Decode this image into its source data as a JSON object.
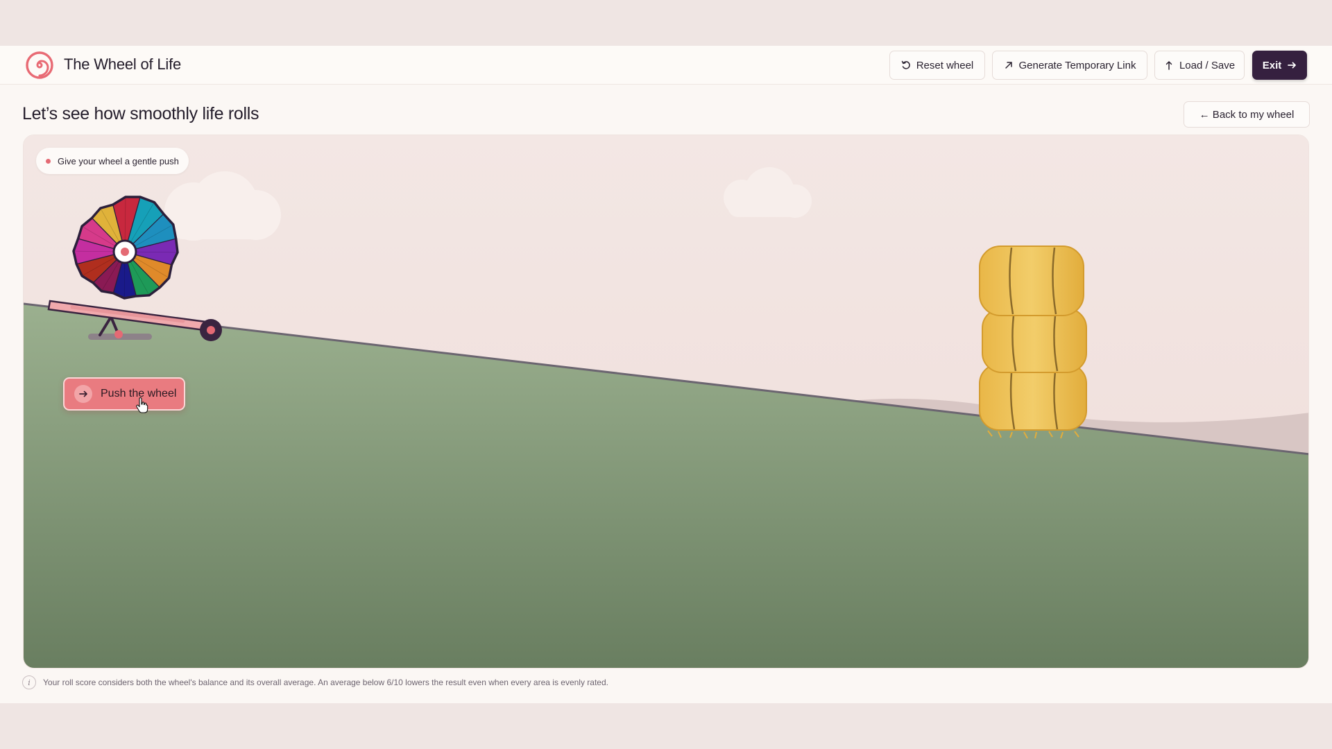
{
  "header": {
    "app_title": "The Wheel of Life",
    "reset_label": "Reset wheel",
    "link_label": "Generate Temporary Link",
    "load_save_label": "Load / Save",
    "exit_label": "Exit"
  },
  "page": {
    "title": "Let’s see how smoothly life rolls",
    "back_label": "← Back to my wheel"
  },
  "scene": {
    "hint": "Give your wheel a gentle push",
    "push_label": "Push the wheel",
    "wheel_segments": [
      "#c8283e",
      "#16a0b8",
      "#1e8fbe",
      "#7a2ab4",
      "#e08a2a",
      "#1e9a58",
      "#1a1a8a",
      "#8a1a54",
      "#b02e1e",
      "#c42ea0",
      "#d63a8a",
      "#e0b23a"
    ],
    "colors": {
      "sky": "#f3e6e3",
      "grass_top": "#9aae8d",
      "grass_bottom": "#6b8063",
      "hay": "#e8b84a",
      "accent": "#e97b80",
      "dark": "#35203f"
    }
  },
  "footer": {
    "note": "Your roll score considers both the wheel's balance and its overall average. An average below 6/10 lowers the result even when every area is evenly rated."
  },
  "icons": {
    "reset": "rotate-ccw-icon",
    "link": "arrow-up-right-icon",
    "load": "upload-icon",
    "exit": "arrow-right-icon",
    "info": "info-icon"
  }
}
